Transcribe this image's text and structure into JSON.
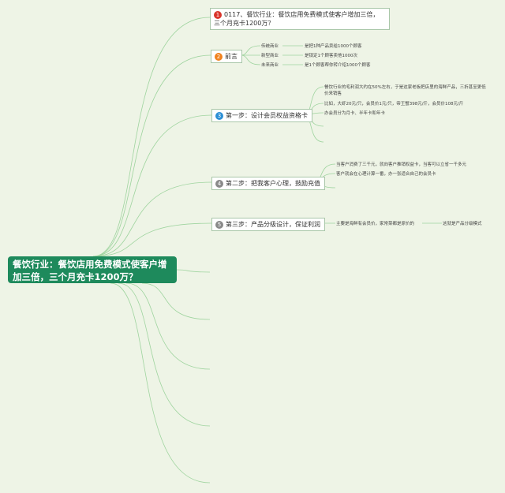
{
  "root": {
    "label": "餐饮行业：餐饮店用免费模式使客户增加三倍，三个月充卡1200万？"
  },
  "colors": {
    "root_bg": "#1e8a5c",
    "link": "#9fd49f",
    "num_1": "#d9342b",
    "num_2": "#f0821e",
    "num_3": "#2d8fd5",
    "num_4": "#8a8a8a",
    "num_5": "#8a8a8a"
  },
  "topics": [
    {
      "num": "1",
      "label": "0117、餐饮行业：餐饮店用免费模式使客户增加三倍，三个月充卡1200万？"
    },
    {
      "num": "2",
      "label": "前言"
    },
    {
      "num": "3",
      "label": "第一步：设计会员权益资格卡"
    },
    {
      "num": "4",
      "label": "第二步：把我客户心理，鼓励充值"
    },
    {
      "num": "5",
      "label": "第三步：产品分级设计，保证利润"
    }
  ],
  "preface": {
    "categories": [
      "传统商业",
      "新型商业",
      "未来商业"
    ],
    "details": [
      "是把1种产品卖给1000个顾客",
      "是锁定1个顾客卖他1000次",
      "是1个顾客帮你转介绍1000个顾客"
    ]
  },
  "step1": {
    "items": [
      "餐饮行业的毛利润大约在50%左右，于是这家老板把店里的海鲜产品，三折甚至更低价来销售",
      "比如，大虾20元/只，会员价1元/只，帝王蟹398元/斤，会员价108元/斤",
      "办会员分为月卡、半年卡和年卡"
    ]
  },
  "step2": {
    "items": [
      "当客户消费了三千元，就向客户推销权益卡，当客可以立省一千多元",
      "客户就会在心理计算一番，办一张适合自己的会员卡"
    ]
  },
  "step3": {
    "items": [
      "主要是海鲜有会员价，家常菜都是原价的",
      "这就是产品分级模式"
    ]
  }
}
